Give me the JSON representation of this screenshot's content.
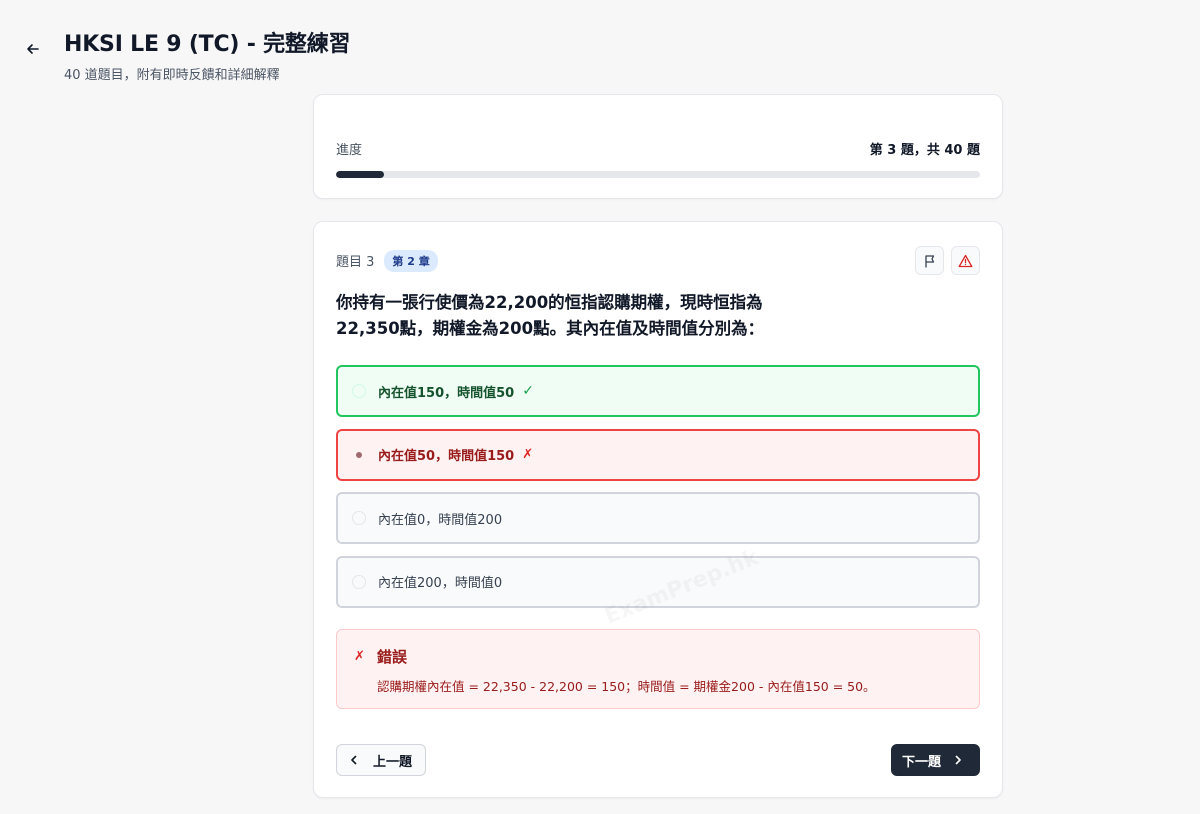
{
  "header": {
    "title": "HKSI LE 9 (TC) - 完整練習",
    "subtitle": "40 道題目，附有即時反饋和詳細解釋"
  },
  "progress": {
    "label": "進度",
    "count_text": "第 3 題，共 40 題",
    "fraction": 0.075
  },
  "question": {
    "number_label": "題目 3",
    "chapter_badge": "第 2 章",
    "text_line1": "你持有一張行使價為22,200的恒指認購期權，現時恒指為",
    "text_line2": "22,350點，期權金為200點。其內在值及時間值分別為：",
    "options": [
      {
        "text": "內在值150，時間值50",
        "status": "correct",
        "mark": "✓"
      },
      {
        "text": "內在值50，時間值150",
        "status": "wrong",
        "mark": "✗"
      },
      {
        "text": "內在值0，時間值200",
        "status": "neutral",
        "mark": ""
      },
      {
        "text": "內在值200，時間值0",
        "status": "neutral",
        "mark": ""
      }
    ]
  },
  "feedback": {
    "icon": "✗",
    "title": "錯誤",
    "text": "認購期權內在值 = 22,350 - 22,200 = 150；時間值 = 期權金200 - 內在值150 = 50。"
  },
  "watermark": "ExamPrep.hk",
  "nav": {
    "prev_label": "上一題",
    "next_label": "下一題"
  },
  "colors": {
    "accent_dark": "#1f2937",
    "correct": "#22c55e",
    "wrong": "#ef4444",
    "badge_bg": "#dbeafe"
  }
}
